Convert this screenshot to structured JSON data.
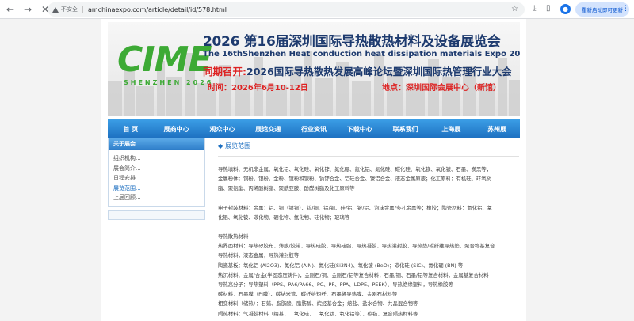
{
  "browser": {
    "security_label": "不安全",
    "url": "amchinaexpo.com/article/detail/id/578.html",
    "update_button": "重新启动即可更新",
    "back_icon": "back-arrow-icon",
    "forward_icon": "forward-arrow-icon",
    "reload_icon": "close-icon"
  },
  "banner": {
    "logo": "CIME",
    "logo_sub": "SHENZHEN 2026",
    "title": "2026 第16届深圳国际导热散热材料及设备展览会",
    "title_en": "The 16thShenzhen Heat conduction heat dissipation materials Expo 2026",
    "concurrent_label": "同期召开:",
    "concurrent_text": "2026国际导热散热发展高峰论坛暨深圳国际热管理行业大会",
    "time": "时间：2026年6月10-12日",
    "location": "地点：深圳国际会展中心（新馆）"
  },
  "nav": [
    "首 页",
    "展商中心",
    "观众中心",
    "展馆交通",
    "行业资讯",
    "下载中心",
    "联系我们",
    "上海展",
    "苏州展"
  ],
  "sidebar": {
    "heading": "关于展会",
    "items": [
      "组织机构...",
      "展会简介...",
      "日程安排...",
      "展览范围...",
      "上届回顾..."
    ],
    "active_index": 3
  },
  "content": {
    "title": "展览范围",
    "paragraphs": [
      [
        "导热填料：无机非金属：氧化铝、氧化硅、氧化锌、氮化硼、氮化铝、氮化硅、碳化硅、氧化镁、氧化铍、石墨、炭黑等；",
        "金属粉体：铜粉、银粉、金粉、镀粉和银粉、钠钾合金、铝硅合金、镍铝合金、液态金属原液；化工原料：有机硅、环氧树",
        "脂、聚氨酯、丙烯酸树脂、聚酰亚胺、酚醛树脂及化工原料等"
      ],
      [
        "电子封装材料：金属：铝、铜（镀铜）、钨/铜、铝/铜、硅/铝、铍/铝、泡沫金属/多孔金属等；橡胶；陶瓷材料：氮化铝、氧",
        "化铝、氧化铍、碳化物、硼化物、氮化物、硅化物；玻璃等"
      ],
      [
        "导热散热材料",
        "热界面材料：导热矽胶布、薄膜/胶带、导热硅胶、导热硅脂、导热凝胶、导热灌封胶、导热垫/碳纤维导热垫、聚合物基复合",
        "导热材料，液态金属，导热灌封胶等",
        "陶瓷基板：氧化铝 (Al2O3)、氮化铝 (AlN)、氮化硅(Si3N4)、氧化铍 (BeO)；碳化硅 (SiC)、氮化硼 (BN) 等",
        "热沉材料：金属/合金(半固态压铸件)；金刚石/铜、金刚石/铝等复合材料，石墨/铜、石墨/铝等复合材料，金属基复合材料",
        "导热高分子：导热塑料（PPS、PA6/PA66、PC、PP、PPA、LDPE、PEEK）、导热绝缘塑料，导热橡胶等",
        "碳材料：石墨膜（PI膜）、碳纳米管、碳纤维短纤、石墨烯导热膜、金刚石材料等",
        "相变材料（储热）：石蜡、脂肪酸、脂肪醇、烷烃基合金；熔盐、盐水合物、共晶混合物等",
        "隔热材料：气凝胶材料（纳基、二氧化硅、二氧化钛、氧化铝等）、碳毡、复合隔热材料等"
      ]
    ]
  },
  "colors": {
    "nav_blue": "#1d6fc0",
    "logo_green": "#3daa35",
    "banner_red": "#dd2222",
    "title_navy": "#1d3a6e"
  }
}
